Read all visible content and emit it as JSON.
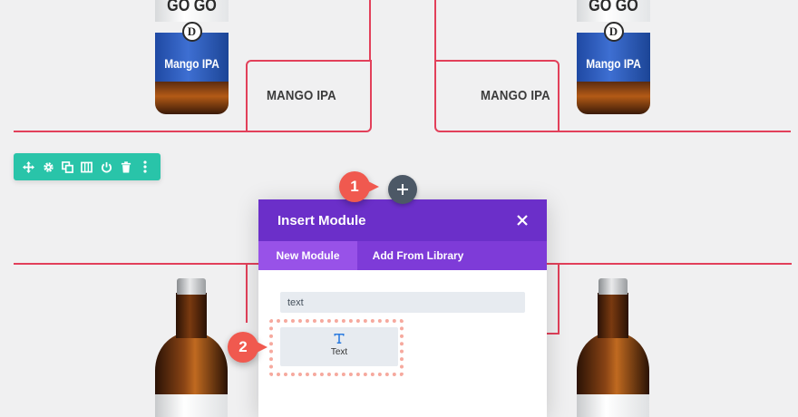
{
  "products": {
    "top_left_label": "MANGO IPA",
    "top_right_label": "MANGO IPA",
    "bottle_brand": "GO GO",
    "bottle_logo_letter": "D",
    "bottle_flavor": "Mango IPA"
  },
  "row_toolbar": {
    "icons": [
      "move-icon",
      "gear-icon",
      "duplicate-icon",
      "columns-icon",
      "power-icon",
      "trash-icon",
      "more-icon"
    ]
  },
  "add_module": {
    "symbol": "+"
  },
  "callouts": {
    "step_one": "1",
    "step_two": "2"
  },
  "modal": {
    "title": "Insert Module",
    "tabs": [
      {
        "label": "New Module",
        "active": true
      },
      {
        "label": "Add From Library",
        "active": false
      }
    ],
    "search": {
      "value": "text"
    },
    "results": [
      {
        "label": "Text",
        "icon": "text-module-icon"
      }
    ]
  },
  "colors": {
    "layout_line": "#e2405a",
    "toolbar": "#29c4a9",
    "modal_header": "#6b2fc9",
    "modal_tabs": "#7e3bd8",
    "callout": "#f0594f"
  }
}
